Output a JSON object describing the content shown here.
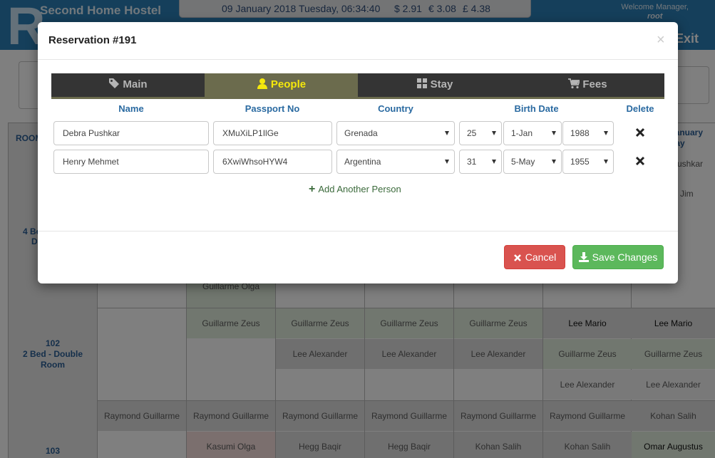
{
  "app": {
    "logo_letter": "R",
    "title": "Second Home Hostel",
    "datetime": "09 January 2018 Tuesday, 06:34:40",
    "currency_usd": "$ 2.91",
    "currency_eur": "€ 3.08",
    "currency_gbp": "£ 4.38",
    "welcome": "Welcome Manager,",
    "user": "root",
    "exit_label": "Exit"
  },
  "background": {
    "room_header": "ROOM",
    "date_header": [
      "January",
      "day"
    ],
    "room_101_label": [
      "4 Be",
      "D"
    ],
    "room_102_label": "102\n2 Bed - Double\nRoom",
    "room_103_label": "103",
    "side_names": [
      "Pushkar",
      "Jim"
    ],
    "cell_guillarme_olga": "Guillarme Olga",
    "rows": [
      [
        "",
        "Guillarme Zeus",
        "Guillarme Zeus",
        "Guillarme Zeus",
        "Guillarme Zeus",
        "Lee Mario",
        "Lee Mario"
      ],
      [
        "",
        "",
        "Lee Alexander",
        "Lee Alexander",
        "Lee Alexander",
        "Guillarme Zeus",
        "Guillarme Zeus"
      ],
      [
        "",
        "",
        "",
        "",
        "",
        "Lee Alexander",
        "Lee Alexander"
      ],
      [
        "Raymond Guillarme",
        "Raymond Guillarme",
        "Raymond Guillarme",
        "Raymond Guillarme",
        "Raymond Guillarme",
        "Raymond Guillarme",
        "Kohan Salih"
      ],
      [
        "",
        "Kasumi Olga",
        "Hegg Baqir",
        "Hegg Baqir",
        "Kohan Salih",
        "Kohan Salih",
        "Omar Augustus"
      ]
    ]
  },
  "modal": {
    "title": "Reservation #191",
    "close_glyph": "×",
    "tabs": [
      {
        "label": "Main",
        "icon": "tag-icon"
      },
      {
        "label": "People",
        "icon": "user-icon",
        "active": true
      },
      {
        "label": "Stay",
        "icon": "grid-icon"
      },
      {
        "label": "Fees",
        "icon": "cart-icon"
      }
    ],
    "columns": [
      "Name",
      "Passport No",
      "Country",
      "Birth Date",
      "Delete"
    ],
    "people": [
      {
        "name": "Debra Pushkar",
        "passport": "XMuXiLP1IlGe",
        "country": "Grenada",
        "day": "25",
        "month": "1-Jan",
        "year": "1988"
      },
      {
        "name": "Henry Mehmet",
        "passport": "6XwiWhsoHYW4",
        "country": "Argentina",
        "day": "31",
        "month": "5-May",
        "year": "1955"
      }
    ],
    "add_person_label": "Add Another Person",
    "cancel_label": "Cancel",
    "save_label": "Save Changes",
    "colors": {
      "tab_bar": "#343434",
      "tab_active": "#6b6b4d",
      "tab_active_text": "#f5e80c",
      "cancel": "#d9534f",
      "save": "#5cb85c"
    }
  }
}
